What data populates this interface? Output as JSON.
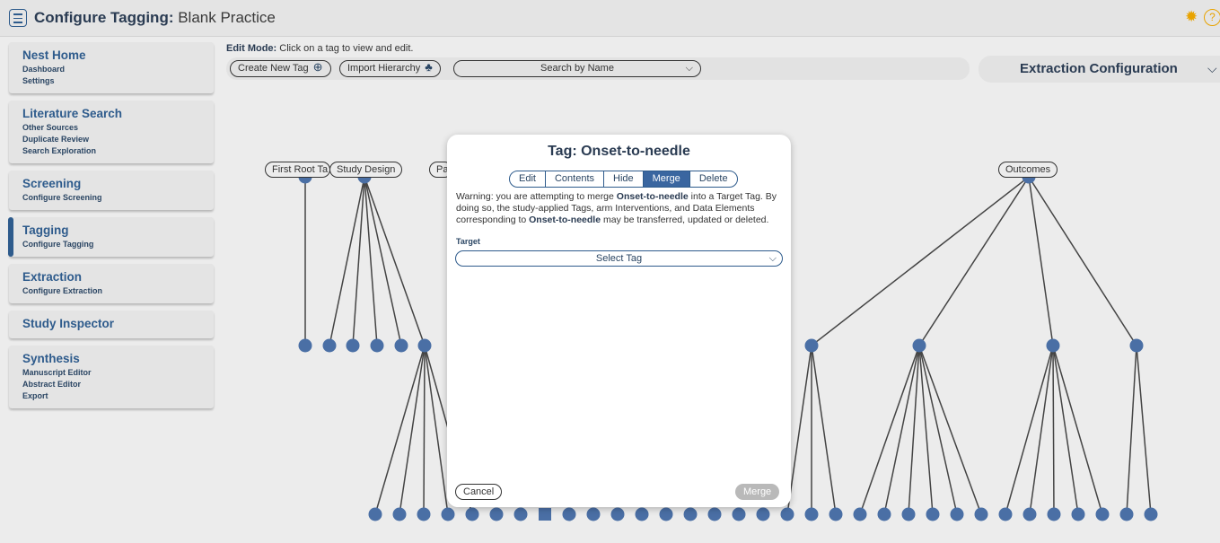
{
  "header": {
    "title_bold": "Configure Tagging:",
    "title_rest": " Blank Practice",
    "menu_icon": "hamburger-icon",
    "bulb_icon": "lightbulb-icon",
    "help_icon": "help-icon"
  },
  "sidebar": {
    "nest_home": {
      "title": "Nest Home",
      "links": [
        "Dashboard",
        "Settings"
      ]
    },
    "literature_search": {
      "title": "Literature Search",
      "links": [
        "Other Sources",
        "Duplicate Review",
        "Search Exploration"
      ]
    },
    "screening": {
      "title": "Screening",
      "links": [
        "Configure Screening"
      ]
    },
    "tagging": {
      "title": "Tagging",
      "links": [
        "Configure Tagging"
      ]
    },
    "extraction": {
      "title": "Extraction",
      "links": [
        "Configure Extraction"
      ]
    },
    "study_inspector": {
      "title": "Study Inspector"
    },
    "synthesis": {
      "title": "Synthesis",
      "links": [
        "Manuscript Editor",
        "Abstract Editor",
        "Export"
      ]
    }
  },
  "editmode": {
    "label": "Edit Mode:",
    "text": " Click on a tag to view and edit."
  },
  "toolbar": {
    "create_new_tag": "Create New Tag",
    "import_hierarchy": "Import Hierarchy",
    "search_placeholder": "Search by Name",
    "plus_icon": "plus-circle-icon",
    "hierarchy_icon": "hierarchy-icon",
    "chevron_icon": "chevron-down-icon"
  },
  "extraction_config": {
    "label": "Extraction Configuration"
  },
  "tree_labels": {
    "first_root": "First Root Ta",
    "study_design": "Study Design",
    "partial": "Pa",
    "outcomes": "Outcomes"
  },
  "modal": {
    "title": "Tag: Onset-to-needle",
    "tabs": [
      "Edit",
      "Contents",
      "Hide",
      "Merge",
      "Delete"
    ],
    "active_tab": "Merge",
    "warning_1": "Warning: you are attempting to merge ",
    "tag_name": "Onset-to-needle",
    "warning_2": " into a Target Tag. By doing so, the study-applied Tags, arm Interventions, and Data Elements corresponding to ",
    "warning_3": " may be transferred, updated or deleted.",
    "target_label": "Target",
    "select_placeholder": "Select Tag",
    "cancel": "Cancel",
    "merge": "Merge"
  },
  "colors": {
    "node": "#4a6fa5",
    "edge": "#444444",
    "accent": "#2e5b8c",
    "merge_disabled": "#b9b9b9"
  }
}
